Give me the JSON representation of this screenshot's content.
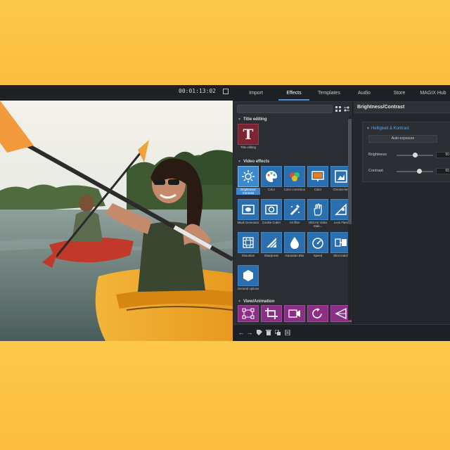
{
  "preview": {
    "timecode": "00:01:13:02"
  },
  "tabs": [
    {
      "label": "Import"
    },
    {
      "label": "Effects"
    },
    {
      "label": "Templates"
    },
    {
      "label": "Audio"
    },
    {
      "label": "Store"
    },
    {
      "label": "MAGIX Hub"
    }
  ],
  "effects_panel": {
    "search_placeholder": "",
    "sections": {
      "title_editing": "Title editing",
      "video_effects": "Video effects",
      "view_animation": "View/Animation"
    },
    "title_tile": {
      "label": "Title editing",
      "glyph": "T"
    },
    "video_tiles": [
      {
        "label": "Brightness/ Contrast",
        "icon": "sun-gear-icon"
      },
      {
        "label": "Color",
        "icon": "palette-icon"
      },
      {
        "label": "Color correction",
        "icon": "color-wheel-icon"
      },
      {
        "label": "Color",
        "icon": "color-screen-icon"
      },
      {
        "label": "Chroma key",
        "icon": "chroma-key-icon"
      },
      {
        "label": "Mask Generator",
        "icon": "mask-icon"
      },
      {
        "label": "Cookie Cutter",
        "icon": "cookie-cutter-icon"
      },
      {
        "label": "Art filter",
        "icon": "art-filter-icon"
      },
      {
        "label": "VEGAS Video Stab...",
        "icon": "stabilizer-hand-icon"
      },
      {
        "label": "Lens Flare",
        "icon": "lens-flare-icon"
      },
      {
        "label": "Distortion",
        "icon": "distortion-grid-icon"
      },
      {
        "label": "Sharpness",
        "icon": "sharpness-icon"
      },
      {
        "label": "Gaussian Blur",
        "icon": "blur-drop-icon"
      },
      {
        "label": "Speed",
        "icon": "speed-gauge-icon"
      },
      {
        "label": "Shot match",
        "icon": "shot-match-icon"
      },
      {
        "label": "General options",
        "icon": "hexagon-icon"
      }
    ],
    "animation_tiles": [
      {
        "icon": "motion-path-icon"
      },
      {
        "icon": "crop-icon"
      },
      {
        "icon": "camera-pan-icon"
      },
      {
        "icon": "rotate-icon"
      },
      {
        "icon": "perspective-icon"
      }
    ]
  },
  "properties": {
    "title": "Brightness/Contrast",
    "group": "Helligkeit & Kontrast",
    "auto_button": "Auto-exposure",
    "brightness": {
      "label": "Brightness",
      "value": "50",
      "fraction": 0.5
    },
    "contrast": {
      "label": "Contrast",
      "value": "65",
      "fraction": 0.65
    }
  },
  "colors": {
    "background": "#fcc244",
    "accent": "#4a90d6",
    "video_effect_tile": "#2c6fae",
    "animation_tile": "#8b2f86",
    "title_tile": "#7b2533"
  }
}
